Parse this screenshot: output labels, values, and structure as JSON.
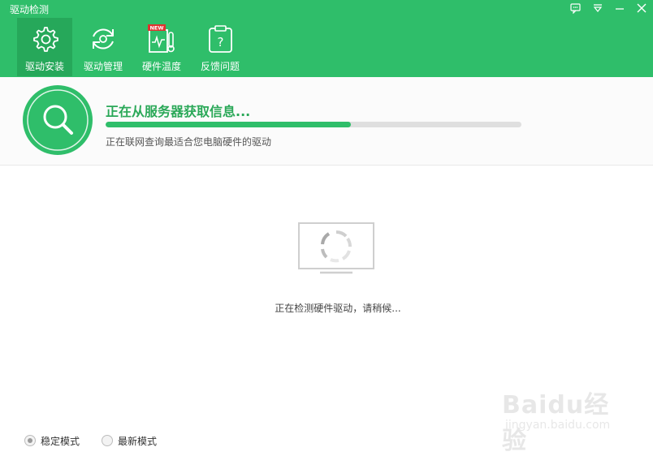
{
  "window": {
    "title": "驱动检测",
    "controls": [
      "feedback-icon",
      "menu-icon",
      "minimize-icon",
      "close-icon"
    ]
  },
  "tabs": [
    {
      "label": "驱动安装",
      "icon": "gear-icon",
      "active": true
    },
    {
      "label": "驱动管理",
      "icon": "refresh-icon",
      "active": false
    },
    {
      "label": "硬件温度",
      "icon": "thermometer-icon",
      "active": false,
      "badge": "NEW"
    },
    {
      "label": "反馈问题",
      "icon": "question-icon",
      "active": false
    }
  ],
  "status": {
    "title": "正在从服务器获取信息...",
    "subtitle": "正在联网查询最适合您电脑硬件的驱动",
    "progress_percent": 59
  },
  "main": {
    "detect_text": "正在检测硬件驱动，请稍候..."
  },
  "modes": [
    {
      "label": "稳定模式",
      "checked": true
    },
    {
      "label": "最新模式",
      "checked": false
    }
  ],
  "watermark": {
    "text": "Baidu经验",
    "sub": "jingyan.baidu.com"
  },
  "colors": {
    "accent": "#2fbe6a",
    "accent_dark": "#26a85a",
    "title_green": "#2aa858"
  }
}
